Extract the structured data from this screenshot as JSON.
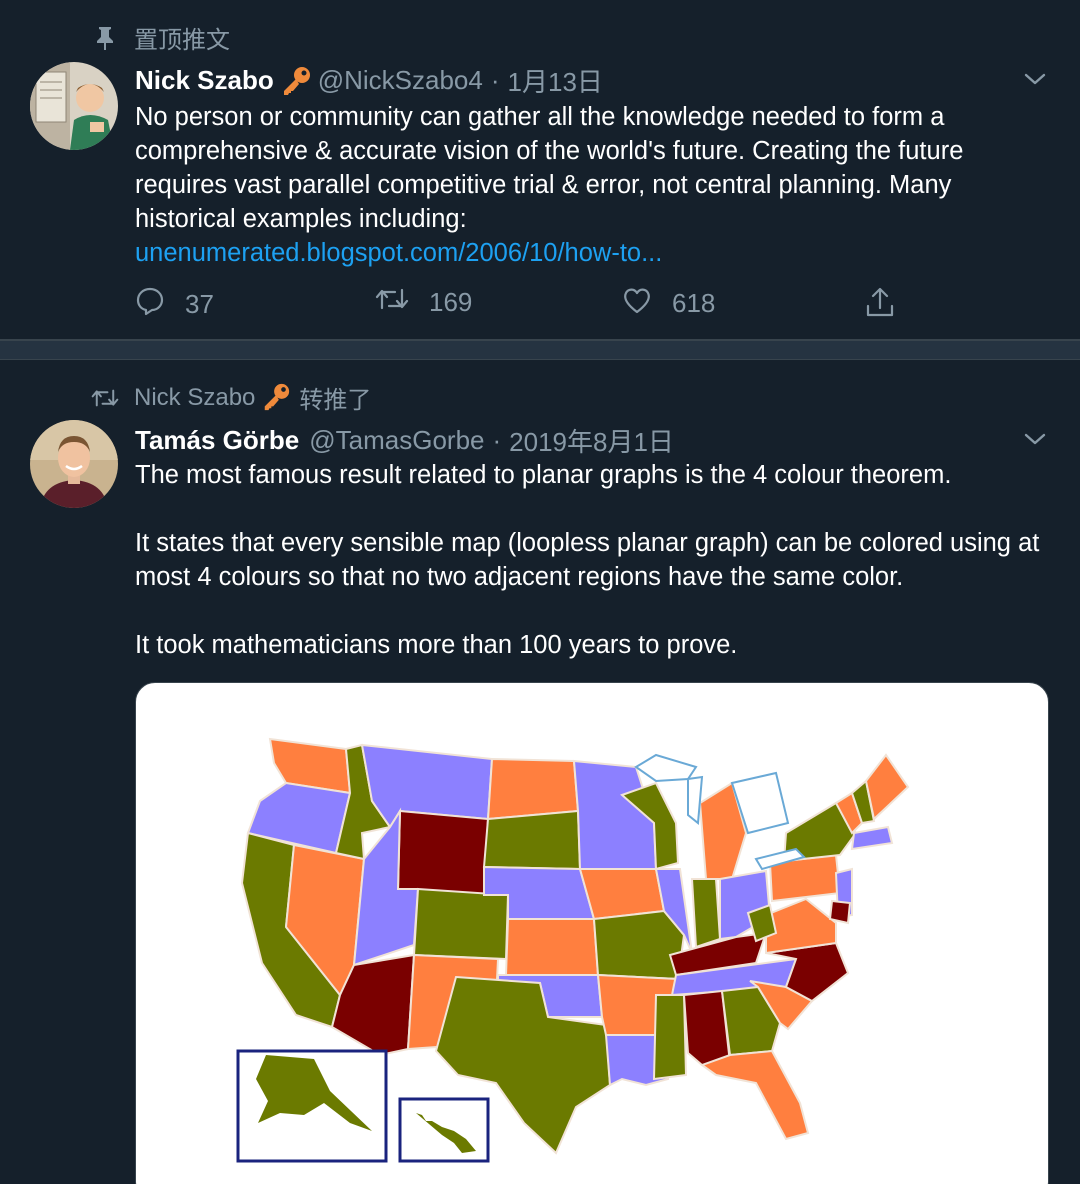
{
  "colors": {
    "background": "#15202b",
    "secondary_text": "#8899a6",
    "link": "#1da1f2",
    "map_orange": "#ff7f3f",
    "map_purple": "#8c80ff",
    "map_olive": "#6b7a00",
    "map_maroon": "#7a0000"
  },
  "pinned_tweet": {
    "context_icon": "pin-icon",
    "context_label": "置顶推文",
    "author_name": "Nick Szabo",
    "author_badge_icon": "key-icon",
    "handle": "@NickSzabo4",
    "separator": "·",
    "date": "1月13日",
    "text_lines": [
      "No person or community can gather all the knowledge needed to form a",
      "comprehensive & accurate vision of the world's future. Creating the future",
      "requires vast parallel competitive trial & error, not central planning. Many",
      "historical examples including:"
    ],
    "link_text": "unenumerated.blogspot.com/2006/10/how-to...",
    "actions": {
      "reply_icon": "reply-icon",
      "reply_count": "37",
      "retweet_icon": "retweet-icon",
      "retweet_count": "169",
      "like_icon": "heart-icon",
      "like_count": "618",
      "share_icon": "share-icon"
    }
  },
  "retweeted_tweet": {
    "context_icon": "retweet-icon",
    "retweeter_name": "Nick Szabo",
    "context_suffix": "转推了",
    "author_name": "Tamás Görbe",
    "handle": "@TamasGorbe",
    "separator": "·",
    "date": "2019年8月1日",
    "paragraphs": [
      "The most famous result related to planar graphs is the 4 colour theorem.",
      "It states that every sensible map (loopless planar graph) can be colored using at most 4 colours so that no two adjacent regions have the same color.",
      "It took mathematicians more than 100 years to prove."
    ],
    "media": {
      "kind": "four-colour-us-map",
      "inset_labels": [
        "alaska-inset",
        "hawaii-inset"
      ]
    }
  }
}
